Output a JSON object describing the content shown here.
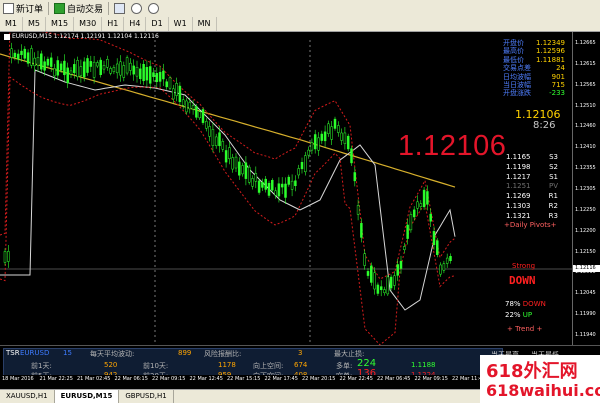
{
  "toolbar": {
    "new_order": "新订单",
    "auto_trading": "自动交易",
    "timeframes": [
      "M1",
      "M5",
      "M15",
      "M30",
      "H1",
      "H4",
      "D1",
      "W1",
      "MN"
    ]
  },
  "chart": {
    "title": "EURUSD,M15  1.12174 1.12191 1.12104 1.12116",
    "big_price": "1.12106",
    "current_price": "1.12106",
    "countdown": "8:26",
    "stats": [
      {
        "label": "开盘价",
        "value": "1.12349"
      },
      {
        "label": "最高价",
        "value": "1.12596"
      },
      {
        "label": "最低价",
        "value": "1.11881"
      },
      {
        "label": "交易点差",
        "value": "24"
      },
      {
        "label": "日均波幅",
        "value": "901"
      },
      {
        "label": "当日波幅",
        "value": "715"
      },
      {
        "label": "开盘涨跌",
        "value": "-233"
      }
    ],
    "pivots": [
      {
        "value": "1.1165",
        "label": "S3"
      },
      {
        "value": "1.1198",
        "label": "S2"
      },
      {
        "value": "1.1217",
        "label": "S1"
      },
      {
        "value": "1.1251",
        "label": "PV"
      },
      {
        "value": "1.1269",
        "label": "R1"
      },
      {
        "value": "1.1303",
        "label": "R2"
      },
      {
        "value": "1.1321",
        "label": "R3"
      }
    ],
    "pivot_title": "+Daily Pivots+",
    "strength_label": "Strong",
    "direction": "DOWN",
    "down_pct": "78%",
    "down_label": "DOWN",
    "up_pct": "22%",
    "up_label": "UP",
    "trend_label": "+ Trend +",
    "price_ticks": [
      "1.12665",
      "1.12615",
      "1.12565",
      "1.12510",
      "1.12460",
      "1.12410",
      "1.12355",
      "1.12305",
      "1.12250",
      "1.12200",
      "1.12150",
      "1.12095",
      "1.12045",
      "1.11990",
      "1.11940"
    ],
    "current_tag": "1.12116",
    "time_labels": [
      "18 Mar 2016",
      "21 Mar 22:25",
      "21 Mar 02:45",
      "22 Mar 06:15",
      "22 Mar 09:15",
      "22 Mar 12:45",
      "22 Mar 15:15",
      "22 Mar 17:45",
      "22 Mar 20:15",
      "22 Mar 22:45",
      "22 Mar 06:45",
      "22 Mar 09:15",
      "22 Mar 11:45",
      "22 Mar 14:15"
    ],
    "chart_data": {
      "type": "candlestick",
      "symbol": "EURUSD",
      "timeframe": "M15",
      "ylim": [
        1.119,
        1.127
      ]
    }
  },
  "tsr": {
    "symbol_tag": "TSR",
    "symbol": "EURUSD",
    "period": "15",
    "avg_range_label": "每天平均波动:",
    "avg_range_value": "899",
    "risk_label": "风险报酬比:",
    "risk_value": "3",
    "max_stop_label": "最大止损:",
    "prev_day_label": "前1天:",
    "prev_day_value": "520",
    "prev10_label": "前10天:",
    "prev10_value": "1178",
    "up_space_label": "向上空间:",
    "up_space_value": "674",
    "buy_label": "多单:",
    "buy_value": "224",
    "buy_price": "1.1188",
    "prev2_label": "前5天:",
    "prev2_value": "942",
    "prev20_label": "前20天:",
    "prev20_value": "959",
    "down_space_label": "向下空间:",
    "down_space_value": "408",
    "sell_label": "空单:",
    "sell_value": "136",
    "sell_price": "1.1224",
    "right1": "当天最高",
    "right2": "当天最低"
  },
  "tabs": [
    "XAUUSD,H1",
    "EURUSD,M15",
    "GBPUSD,H1"
  ],
  "watermark": {
    "line1": "618外汇网",
    "line2": "618waihui.com"
  }
}
